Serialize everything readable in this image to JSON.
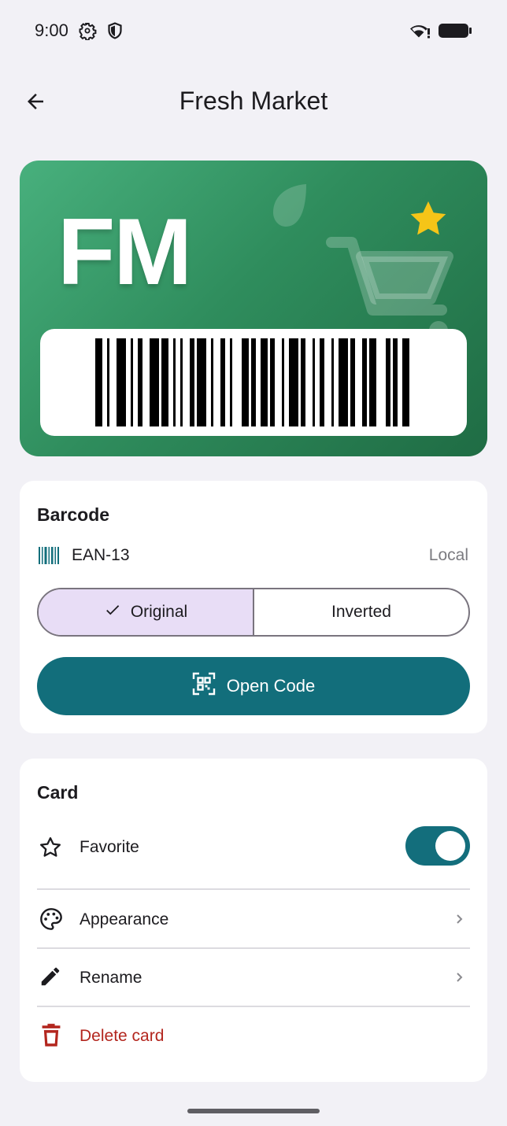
{
  "status_bar": {
    "time": "9:00",
    "left_icons": [
      "gear-icon",
      "shield-icon"
    ],
    "right_icons": [
      "wifi-alert-icon",
      "battery-icon"
    ]
  },
  "app_bar": {
    "back_icon": "arrow-left-icon",
    "title": "Fresh Market"
  },
  "card": {
    "initials": "FM",
    "gradient_colors": [
      "#48b07d",
      "#1f6c44"
    ],
    "decorations": [
      "leaf-icon",
      "cart-icon",
      "star-icon"
    ],
    "star_color": "#f5c518"
  },
  "barcode_section": {
    "title": "Barcode",
    "format_icon": "barcode-icon",
    "format": "EAN-13",
    "source": "Local",
    "options": [
      {
        "label": "Original",
        "selected": true
      },
      {
        "label": "Inverted",
        "selected": false
      }
    ],
    "open_button": {
      "label": "Open Code",
      "icon": "qr-scan-icon",
      "color": "#126e7b"
    }
  },
  "card_section": {
    "title": "Card",
    "favorite": {
      "label": "Favorite",
      "icon": "star-outline-icon",
      "enabled": true
    },
    "appearance": {
      "label": "Appearance",
      "icon": "palette-icon"
    },
    "rename": {
      "label": "Rename",
      "icon": "pencil-icon"
    },
    "delete": {
      "label": "Delete card",
      "icon": "trash-icon",
      "color": "#b3261e"
    }
  }
}
